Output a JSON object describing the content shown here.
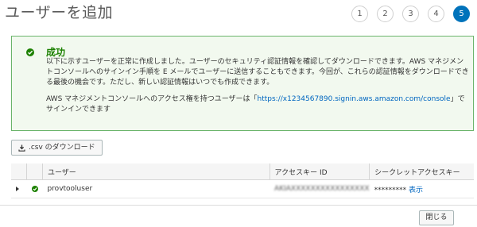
{
  "page": {
    "title": "ユーザーを追加"
  },
  "steps": [
    "1",
    "2",
    "3",
    "4",
    "5"
  ],
  "active_step": 5,
  "success": {
    "title": "成功",
    "paragraph1": "以下に示すユーザーを正常に作成しました。ユーザーのセキュリティ認証情報を確認してダウンロードできます。AWS マネジメントコンソールへのサインイン手順を E メールでユーザーに送信することもできます。今回が、これらの認証情報をダウンロードできる最後の機会です。ただし、新しい認証情報はいつでも作成できます。",
    "paragraph2_prefix": "AWS マネジメントコンソールへのアクセス権を持つユーザーは「",
    "console_url": "https://x1234567890.signin.aws.amazon.com/console",
    "paragraph2_suffix": "」でサインインできます"
  },
  "csv_button_label": ".csv のダウンロード",
  "table": {
    "columns": [
      "",
      "",
      "ユーザー",
      "アクセスキー ID",
      "シークレットアクセスキー"
    ],
    "rows": [
      {
        "user": "provtooluser",
        "access_key_id": "AKIAXXXXXXXXXXXXXXXX",
        "secret_masked": "*********",
        "show_label": "表示"
      }
    ]
  },
  "close_button_label": "閉じる",
  "colors": {
    "success": "#1d8102",
    "link": "#0066c0",
    "active_step": "#0073bb"
  },
  "icons": {
    "success": "check-circle-icon",
    "download": "download-icon",
    "expand": "caret-right-icon"
  }
}
